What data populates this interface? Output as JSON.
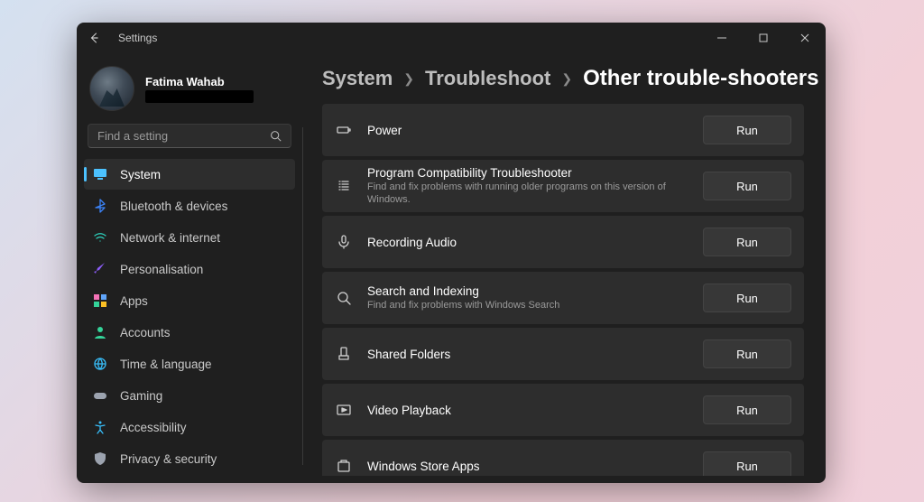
{
  "window": {
    "title": "Settings"
  },
  "profile": {
    "name": "Fatima Wahab"
  },
  "search": {
    "placeholder": "Find a setting"
  },
  "sidebar": {
    "items": [
      {
        "label": "System",
        "icon": "monitor",
        "active": true
      },
      {
        "label": "Bluetooth & devices",
        "icon": "bluetooth"
      },
      {
        "label": "Network & internet",
        "icon": "wifi"
      },
      {
        "label": "Personalisation",
        "icon": "brush"
      },
      {
        "label": "Apps",
        "icon": "apps"
      },
      {
        "label": "Accounts",
        "icon": "person"
      },
      {
        "label": "Time & language",
        "icon": "globe"
      },
      {
        "label": "Gaming",
        "icon": "gamepad"
      },
      {
        "label": "Accessibility",
        "icon": "accessibility"
      },
      {
        "label": "Privacy & security",
        "icon": "shield"
      }
    ]
  },
  "breadcrumbs": {
    "crumb1": "System",
    "crumb2": "Troubleshoot",
    "current": "Other trouble-shooters"
  },
  "run_label": "Run",
  "troubleshooters": [
    {
      "title": "Power",
      "desc": "",
      "icon": "battery"
    },
    {
      "title": "Program Compatibility Troubleshooter",
      "desc": "Find and fix problems with running older programs on this version of Windows.",
      "icon": "list"
    },
    {
      "title": "Recording Audio",
      "desc": "",
      "icon": "mic"
    },
    {
      "title": "Search and Indexing",
      "desc": "Find and fix problems with Windows Search",
      "icon": "search"
    },
    {
      "title": "Shared Folders",
      "desc": "",
      "icon": "shared"
    },
    {
      "title": "Video Playback",
      "desc": "",
      "icon": "video"
    },
    {
      "title": "Windows Store Apps",
      "desc": "",
      "icon": "store"
    }
  ]
}
